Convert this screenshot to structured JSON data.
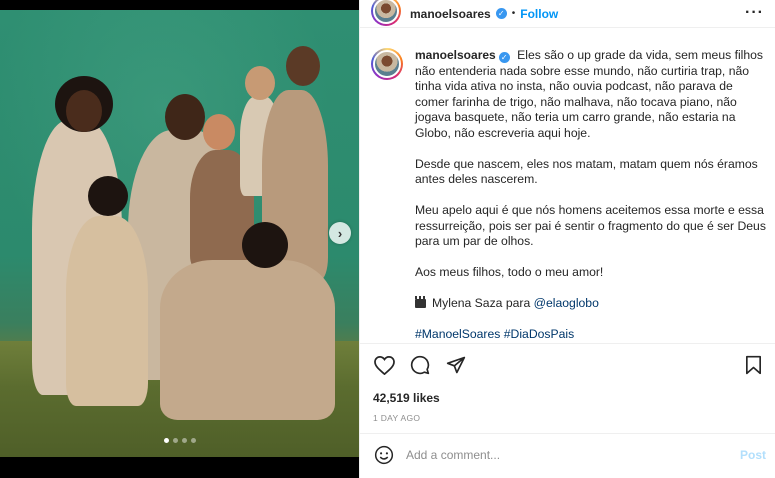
{
  "post": {
    "username": "manoelsoares",
    "verified": true,
    "follow_label": "Follow",
    "more_label": "···",
    "separator": "•"
  },
  "media": {
    "next_label": "›",
    "carousel_count": 4,
    "active_index": 0
  },
  "caption": {
    "username": "manoelsoares",
    "paragraphs": [
      "Eles são o up grade da vida, sem meus filhos não entenderia nada sobre esse mundo, não curtiria trap, não tinha vida ativa no insta, não ouvia podcast, não parava de comer farinha de trigo, não malhava, não tocava piano, não jogava basquete, não teria um carro grande, não estaria na Globo, não escreveria aqui hoje.",
      "Desde que nascem, eles nos matam, matam quem nós éramos antes deles nascerem.",
      "Meu apelo aqui é que nós homens aceitemos essa morte e essa ressurreição, pois ser pai é sentir o fragmento do que é ser Deus para um par de olhos.",
      "Aos meus filhos, todo o meu amor!"
    ],
    "credit_text": "Mylena Saza para",
    "credit_link": "@elaoglobo",
    "hashtags": "#ManoelSoares #DiaDosPais"
  },
  "engagement": {
    "likes": "42,519 likes",
    "time_ago": "1 DAY AGO"
  },
  "comment": {
    "placeholder": "Add a comment...",
    "post_label": "Post"
  },
  "colors": {
    "accent": "#0095f6",
    "link": "#00376b",
    "muted": "#8e8e8e",
    "post_disabled": "#b2dffc"
  },
  "icons": [
    "heart-icon",
    "comment-icon",
    "share-icon",
    "bookmark-icon",
    "emoji-icon",
    "verified-icon",
    "more-icon",
    "clapperboard-icon",
    "chevron-right-icon"
  ]
}
